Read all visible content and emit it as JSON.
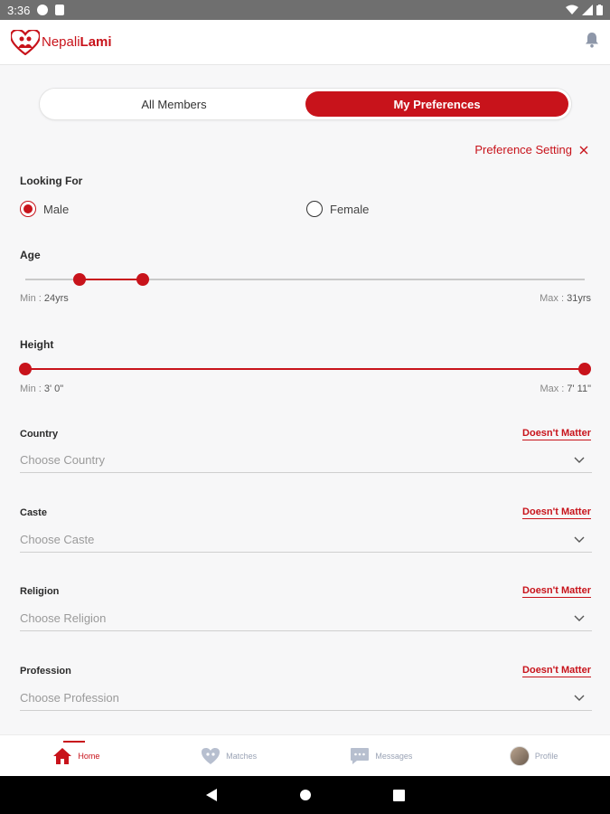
{
  "status_bar": {
    "time": "3:36"
  },
  "header": {
    "brand_part1": "Nepali",
    "brand_part2": "Lami"
  },
  "tabs": [
    {
      "label": "All Members"
    },
    {
      "label": "My Preferences"
    }
  ],
  "preference_setting": {
    "label": "Preference Setting"
  },
  "looking_for": {
    "label": "Looking For",
    "options": [
      "Male",
      "Female"
    ],
    "selected": "Male"
  },
  "age": {
    "label": "Age",
    "min_label": "Min : ",
    "min_value": "24yrs",
    "max_label": "Max : ",
    "max_value": "31yrs",
    "range_start_fraction": 0.097,
    "range_end_fraction": 0.21
  },
  "height": {
    "label": "Height",
    "min_label": "Min : ",
    "min_value": "3' 0\"",
    "max_label": "Max : ",
    "max_value": "7' 11\"",
    "range_start_fraction": 0.0,
    "range_end_fraction": 1.0
  },
  "fields": [
    {
      "label": "Country",
      "placeholder": "Choose Country",
      "action": "Doesn't Matter"
    },
    {
      "label": "Caste",
      "placeholder": "Choose Caste",
      "action": "Doesn't Matter"
    },
    {
      "label": "Religion",
      "placeholder": "Choose Religion",
      "action": "Doesn't Matter"
    },
    {
      "label": "Profession",
      "placeholder": "Choose Profession",
      "action": "Doesn't Matter"
    }
  ],
  "bottom_nav": [
    {
      "label": "Home",
      "icon": "home-icon",
      "active": true
    },
    {
      "label": "Matches",
      "icon": "matches-icon",
      "active": false
    },
    {
      "label": "Messages",
      "icon": "messages-icon",
      "active": false
    },
    {
      "label": "Profile",
      "icon": "avatar",
      "active": false
    }
  ],
  "colors": {
    "accent": "#c8131b",
    "muted": "#9aa3b5"
  }
}
